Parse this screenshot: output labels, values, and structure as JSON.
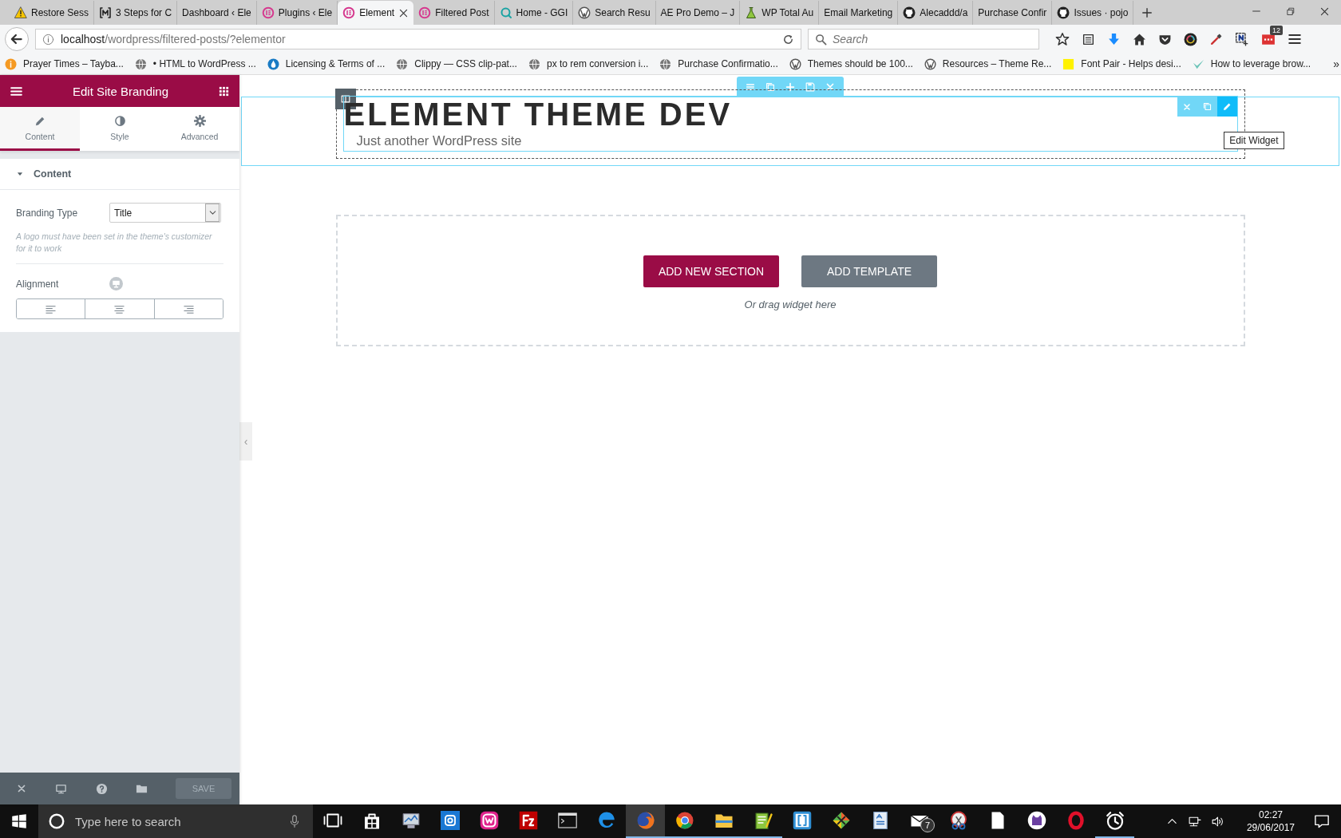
{
  "browser": {
    "tabs": [
      {
        "label": "Restore Sess",
        "selected": false
      },
      {
        "label": "3 Steps for C",
        "selected": false
      },
      {
        "label": "Dashboard ‹ Ele",
        "selected": false
      },
      {
        "label": "Plugins ‹ Ele",
        "selected": false
      },
      {
        "label": "Element",
        "selected": true
      },
      {
        "label": "Filtered Post",
        "selected": false
      },
      {
        "label": "Home - GGI",
        "selected": false
      },
      {
        "label": "Search Resu",
        "selected": false
      },
      {
        "label": "AE Pro Demo – J",
        "selected": false
      },
      {
        "label": "WP Total Au",
        "selected": false
      },
      {
        "label": "Email Marketing",
        "selected": false
      },
      {
        "label": "Alecaddd/a",
        "selected": false
      },
      {
        "label": "Purchase Confir",
        "selected": false
      },
      {
        "label": "Issues · pojo",
        "selected": false
      }
    ],
    "url_host": "localhost",
    "url_path": "/wordpress/filtered-posts/?elementor",
    "search_placeholder": "Search",
    "extension_badge": "12",
    "bookmarks": [
      {
        "label": "Prayer Times – Tayba..."
      },
      {
        "label": "• HTML to WordPress ..."
      },
      {
        "label": "Licensing & Terms of ..."
      },
      {
        "label": "Clippy — CSS clip-pat..."
      },
      {
        "label": "px to rem conversion i..."
      },
      {
        "label": "Purchase Confirmatio..."
      },
      {
        "label": "Themes should be 100..."
      },
      {
        "label": "Resources – Theme Re..."
      },
      {
        "label": "Font Pair - Helps desi..."
      },
      {
        "label": "How to leverage brow..."
      }
    ],
    "bookmarks_more": "»"
  },
  "panel": {
    "title": "Edit Site Branding",
    "tabs": [
      {
        "label": "Content",
        "selected": true
      },
      {
        "label": "Style",
        "selected": false
      },
      {
        "label": "Advanced",
        "selected": false
      }
    ],
    "section": {
      "title": "Content",
      "expanded": true
    },
    "branding_label": "Branding Type",
    "branding_value": "Title",
    "help": "A logo must have been set in the theme's customizer for it to work",
    "alignment_label": "Alignment",
    "alignments": [
      {
        "selected": false
      },
      {
        "selected": false
      },
      {
        "selected": false
      }
    ],
    "save": {
      "label": "SAVE",
      "disabled": true
    }
  },
  "canvas": {
    "site_title": "ELEMENT THEME DEV",
    "tagline": "Just another WordPress site",
    "tooltip": "Edit Widget",
    "add_section": "ADD NEW SECTION",
    "add_template": "ADD TEMPLATE",
    "drag_hint": "Or drag widget here",
    "collapse": "‹"
  },
  "taskbar": {
    "search_placeholder": "Type here to search",
    "apps": [
      {
        "running": false,
        "selected": false
      },
      {
        "running": false,
        "selected": false
      },
      {
        "running": false,
        "selected": false
      },
      {
        "running": false,
        "selected": false
      },
      {
        "running": false,
        "selected": false
      },
      {
        "running": false,
        "selected": false
      },
      {
        "running": false,
        "selected": false
      },
      {
        "running": false,
        "selected": false
      },
      {
        "running": true,
        "selected": true
      },
      {
        "running": true,
        "selected": false
      },
      {
        "running": true,
        "selected": false
      },
      {
        "running": true,
        "selected": false
      },
      {
        "running": false,
        "selected": false
      },
      {
        "running": false,
        "selected": false
      },
      {
        "running": false,
        "selected": false
      },
      {
        "running": false,
        "selected": false,
        "badge": "7"
      },
      {
        "running": false,
        "selected": false
      },
      {
        "running": false,
        "selected": false
      },
      {
        "running": false,
        "selected": false
      },
      {
        "running": false,
        "selected": false
      },
      {
        "running": true,
        "selected": false
      }
    ],
    "time": "02:27",
    "date": "29/06/2017"
  }
}
